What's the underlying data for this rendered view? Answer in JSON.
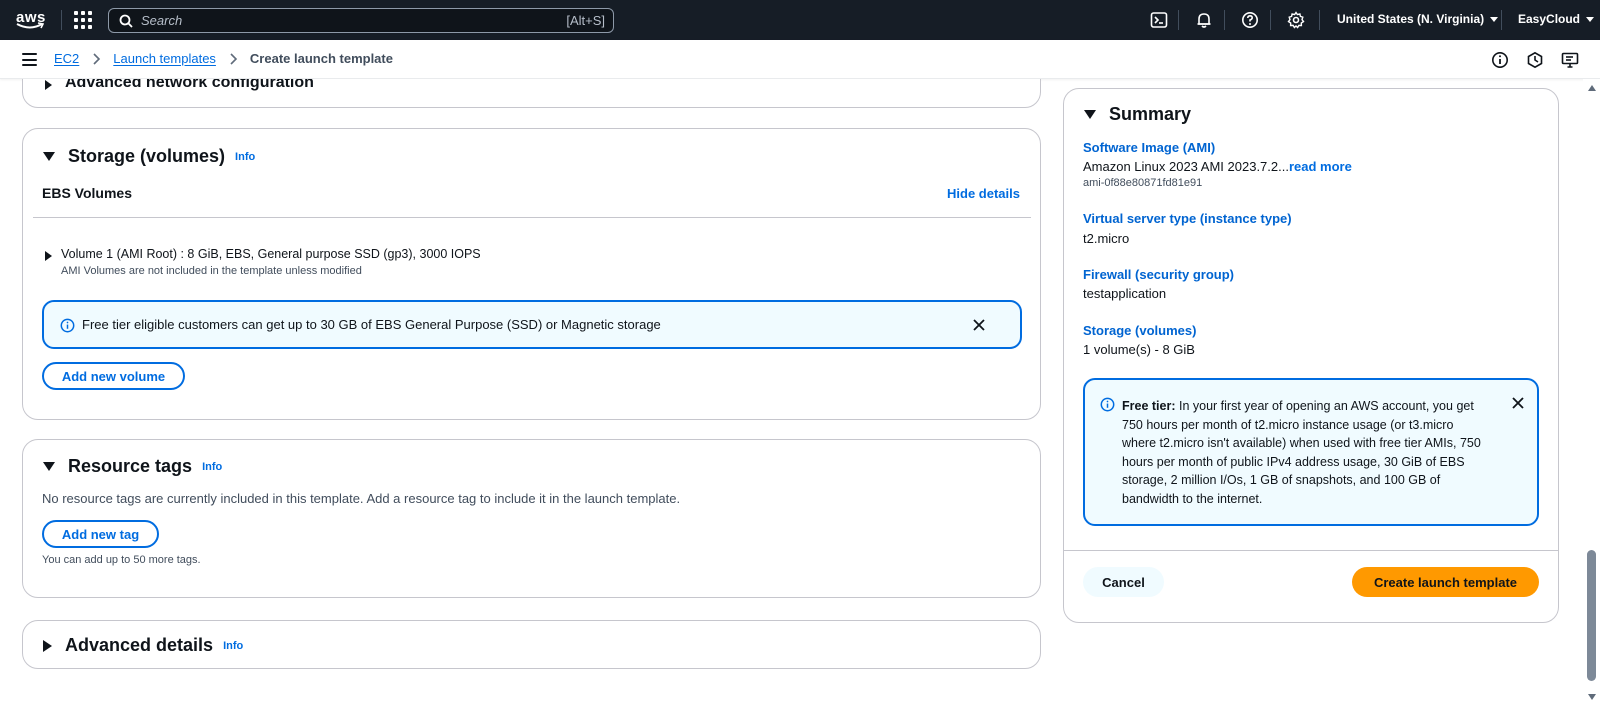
{
  "topnav": {
    "logo_text": "aws",
    "search_placeholder": "Search",
    "search_shortcut": "[Alt+S]",
    "region": "United States (N. Virginia)",
    "account": "EasyCloud",
    "icons": [
      "cloudshell-icon",
      "bell-icon",
      "help-icon",
      "gear-icon"
    ]
  },
  "breadcrumb": {
    "items": [
      "EC2",
      "Launch templates"
    ],
    "current": "Create launch template"
  },
  "network_section": {
    "title": "Advanced network configuration"
  },
  "storage": {
    "title": "Storage (volumes)",
    "info": "Info",
    "subheading": "EBS Volumes",
    "hide_details": "Hide details",
    "volume_title": "Volume 1 (AMI Root) : 8 GiB, EBS, General purpose SSD (gp3), 3000 IOPS",
    "volume_note": "AMI Volumes are not included in the template unless modified",
    "alert": "Free tier eligible customers can get up to 30 GB of EBS General Purpose (SSD) or Magnetic storage",
    "add_volume": "Add new volume"
  },
  "resource_tags": {
    "title": "Resource tags",
    "info": "Info",
    "description": "No resource tags are currently included in this template. Add a resource tag to include it in the launch template.",
    "add_tag": "Add new tag",
    "hint": "You can add up to 50 more tags."
  },
  "advanced_details": {
    "title": "Advanced details",
    "info": "Info"
  },
  "summary": {
    "title": "Summary",
    "ami_label": "Software Image (AMI)",
    "ami_value": "Amazon Linux 2023 AMI 2023.7.2...",
    "read_more": "read more",
    "ami_id": "ami-0f88e80871fd81e91",
    "instance_label": "Virtual server type (instance type)",
    "instance_value": "t2.micro",
    "firewall_label": "Firewall (security group)",
    "firewall_value": "testapplication",
    "storage_label": "Storage (volumes)",
    "storage_value": "1 volume(s) - 8 GiB",
    "free_tier_bold": "Free tier:",
    "free_tier_text": " In your first year of opening an AWS account, you get 750 hours per month of t2.micro instance usage (or t3.micro where t2.micro isn't available) when used with free tier AMIs, 750 hours per month of public IPv4 address usage, 30 GiB of EBS storage, 2 million I/Os, 1 GB of snapshots, and 100 GB of bandwidth to the internet.",
    "cancel": "Cancel",
    "create": "Create launch template"
  },
  "colors": {
    "nav_bg": "#161d26",
    "link": "#006ce0",
    "primary_button": "#ff9900",
    "alert_bg": "#f0fbff"
  }
}
